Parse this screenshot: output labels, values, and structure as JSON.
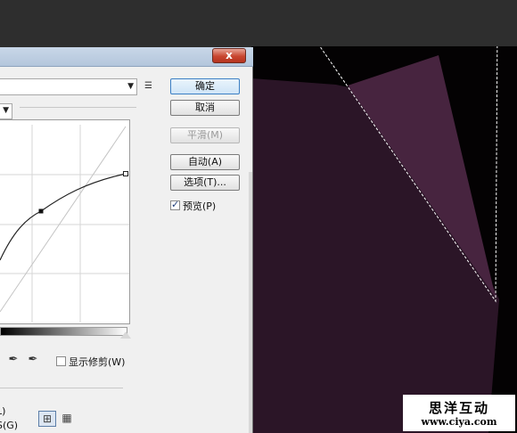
{
  "dialog": {
    "close_label": "x",
    "preset_value": "",
    "buttons": {
      "ok": "确定",
      "cancel": "取消",
      "smooth": "平滑(M)",
      "auto": "自动(A)",
      "options": "选项(T)..."
    },
    "preview_label": "预览(P)",
    "preview_checked": true,
    "show_clipping_label": "显示修剪(W)",
    "show_clipping_checked": false,
    "cut_labels": [
      "L)",
      "S(G)"
    ]
  },
  "watermark": {
    "title": "思洋互动",
    "url": "www.ciya.com"
  }
}
